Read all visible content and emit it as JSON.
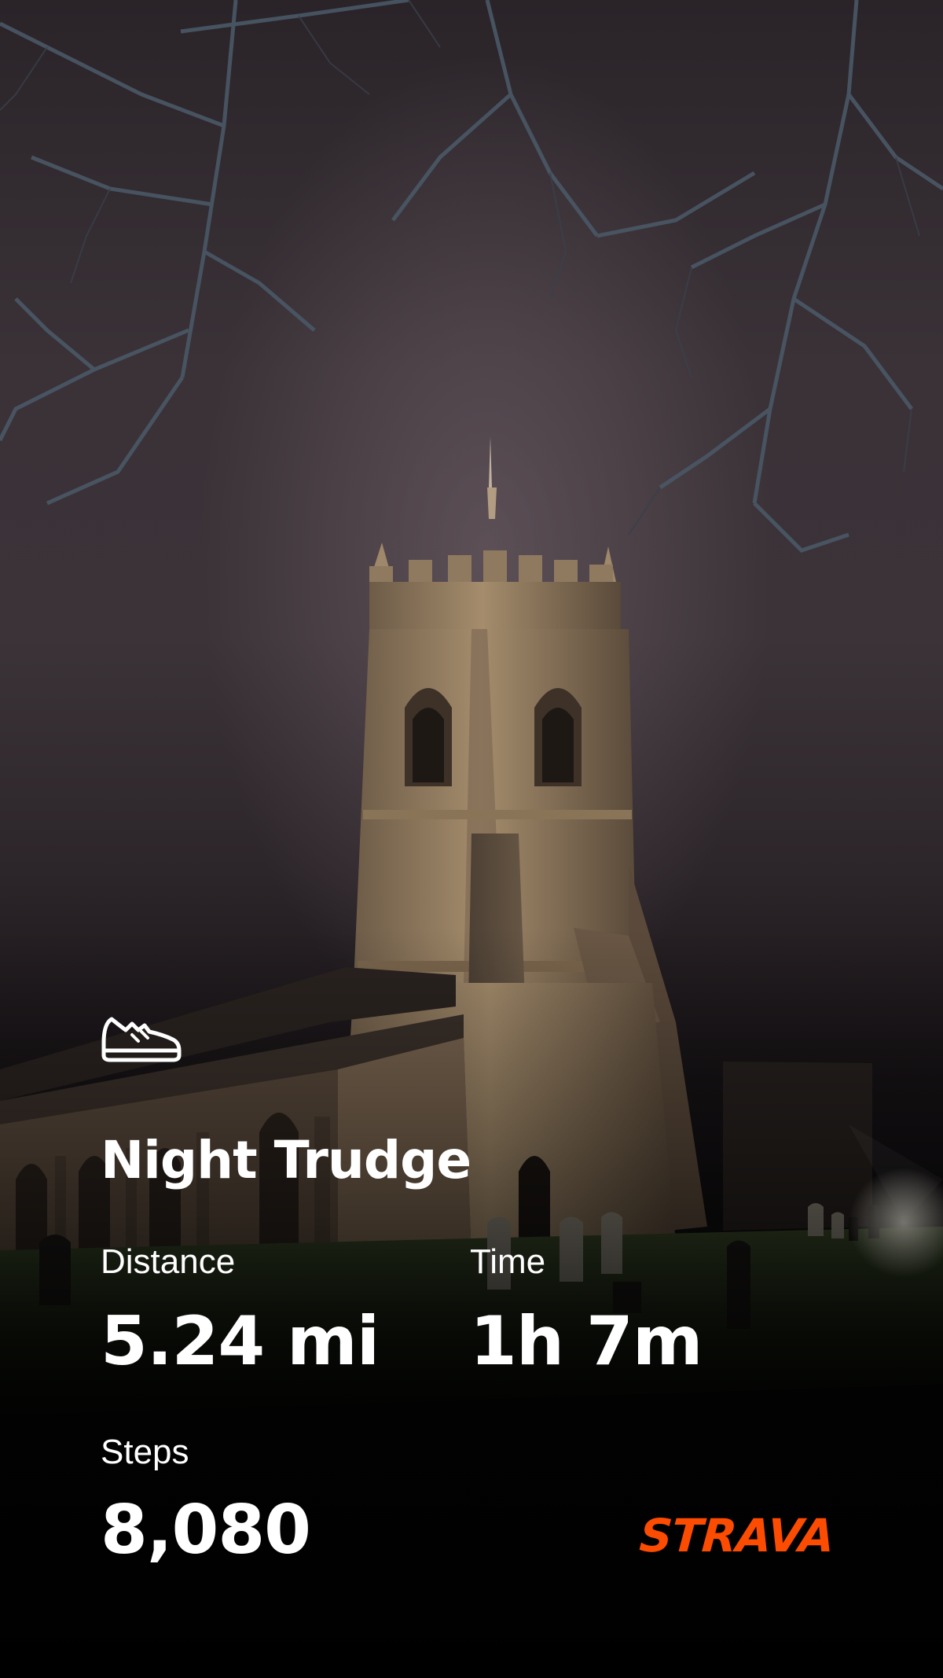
{
  "activity": {
    "icon": "running-shoe-icon",
    "title": "Night Trudge"
  },
  "stats": {
    "distance": {
      "label": "Distance",
      "value": "5.24 mi"
    },
    "time": {
      "label": "Time",
      "value": "1h 7m"
    },
    "steps": {
      "label": "Steps",
      "value": "8,080"
    }
  },
  "brand": {
    "name": "STRAVA",
    "color": "#fc4c02"
  },
  "colors": {
    "text": "#ffffff",
    "background": "#0b0a0c"
  }
}
